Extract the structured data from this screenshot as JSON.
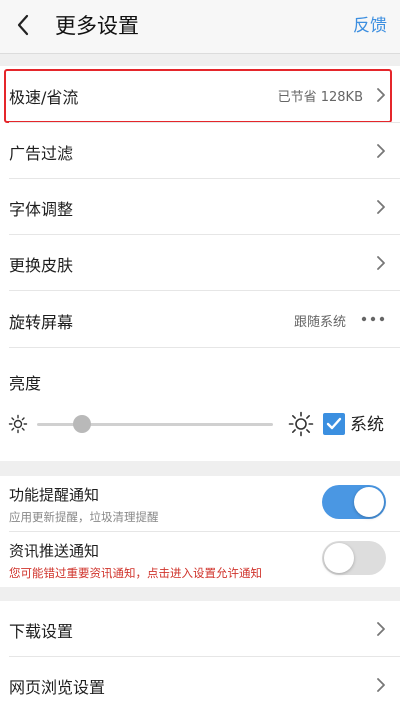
{
  "header": {
    "back_icon": "chevron-left-icon",
    "title": "更多设置",
    "feedback": "反馈"
  },
  "rows": {
    "speed": {
      "label": "极速/省流",
      "value": "已节省 128KB"
    },
    "adfilter": {
      "label": "广告过滤"
    },
    "font": {
      "label": "字体调整"
    },
    "skin": {
      "label": "更换皮肤"
    },
    "rotate": {
      "label": "旋转屏幕",
      "value": "跟随系统"
    },
    "brightness": {
      "label": "亮度",
      "level": 0.19,
      "system_label": "系统",
      "system_checked": true
    }
  },
  "notifications": {
    "feature": {
      "label": "功能提醒通知",
      "sub": "应用更新提醒，垃圾清理提醒",
      "on": true
    },
    "news": {
      "label": "资讯推送通知",
      "sub": "您可能错过重要资讯通知，点击进入设置允许通知",
      "on": false
    }
  },
  "more": {
    "download": {
      "label": "下载设置"
    },
    "browse": {
      "label": "网页浏览设置"
    }
  },
  "colors": {
    "accent": "#3d8fe0",
    "toggle_on": "#4a97e3",
    "toggle_off": "#dddddd",
    "highlight": "#e5262b",
    "warning_text": "#d0342c",
    "sub_text": "#888888"
  }
}
